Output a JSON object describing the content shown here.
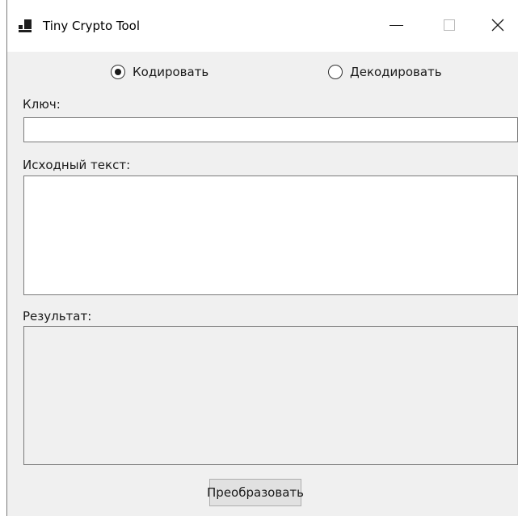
{
  "window": {
    "title": "Tiny Crypto Tool",
    "icon": "app-window-icon",
    "controls": {
      "minimize_icon": "minimize-icon",
      "maximize_icon": "maximize-icon",
      "close_icon": "close-icon",
      "maximize_enabled": false
    }
  },
  "mode": {
    "options": [
      {
        "label": "Кодировать",
        "selected": true
      },
      {
        "label": "Декодировать",
        "selected": false
      }
    ]
  },
  "fields": {
    "key_label": "Ключ:",
    "key_value": "",
    "source_label": "Исходный текст:",
    "source_value": "",
    "result_label": "Результат:",
    "result_value": "",
    "result_readonly": true
  },
  "actions": {
    "convert_label": "Преобразовать"
  },
  "colors": {
    "window_bg": "#f0f0f0",
    "titlebar_bg": "#ffffff",
    "input_bg": "#ffffff",
    "input_border": "#7a7a7a",
    "button_bg": "#e1e1e1",
    "button_border": "#adadad"
  }
}
